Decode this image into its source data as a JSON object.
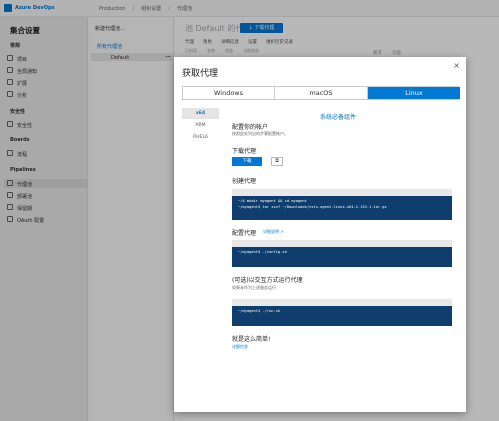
{
  "header": {
    "brand": "Azure DevOps",
    "breadcrumbs": [
      "Production",
      "组织设置",
      "代理池"
    ]
  },
  "leftnav": {
    "title": "集合设置",
    "sections": [
      {
        "label": "常规",
        "items": [
          "项目",
          "全局通知",
          "扩展",
          "分析"
        ]
      },
      {
        "label": "安全性",
        "items": [
          "安全性"
        ]
      },
      {
        "label": "Boards",
        "items": [
          "流程"
        ]
      },
      {
        "label": "Pipelines",
        "items": [
          "代理池",
          "部署池",
          "保留期",
          "OAuth 配置"
        ]
      }
    ]
  },
  "poolpane": {
    "new_pool": "新建代理池...",
    "all_pools": "所有代理池",
    "selected_pool": "Default",
    "more": "..."
  },
  "detail": {
    "title": "池 Default 的代理",
    "download_btn": "↓ 下载代理",
    "tabs": [
      "代理",
      "角色",
      "详细信息",
      "设置",
      "维护历史记录"
    ],
    "subheaders": [
      "已启用",
      "名称",
      "状态",
      "当前状态"
    ],
    "rightcols": [
      "要求",
      "功能"
    ]
  },
  "dialog": {
    "title": "获取代理",
    "close": "×",
    "os_tabs": [
      "Windows",
      "macOS",
      "Linux"
    ],
    "archs": [
      "x64",
      "ARM",
      "RHEL6"
    ],
    "system_prereqs": "系统必备组件",
    "account_heading": "配置你的帐户",
    "account_text": "按照此处列出的步骤配置帐户。",
    "download_heading": "下载代理",
    "download_btn": "下载",
    "copy_icon": "⧉",
    "create_heading": "创建代理",
    "create_code": "~/$ mkdir myagent && cd myagent\n~/myagent$ tar zxvf ~/Downloads/vsts-agent-linux-x64-2.153.1.tar.gz",
    "configure_heading": "配置代理",
    "configure_link": "详细说明 ↗",
    "configure_code": "~/myagent$ ./config.sh",
    "run_heading": "(可选)以交互方式运行代理",
    "run_text": "如果未作为上述服务运行",
    "run_code": "~/myagent$ ./run.sh",
    "easy_heading": "就是这么简单!",
    "easy_link": "详细信息"
  }
}
